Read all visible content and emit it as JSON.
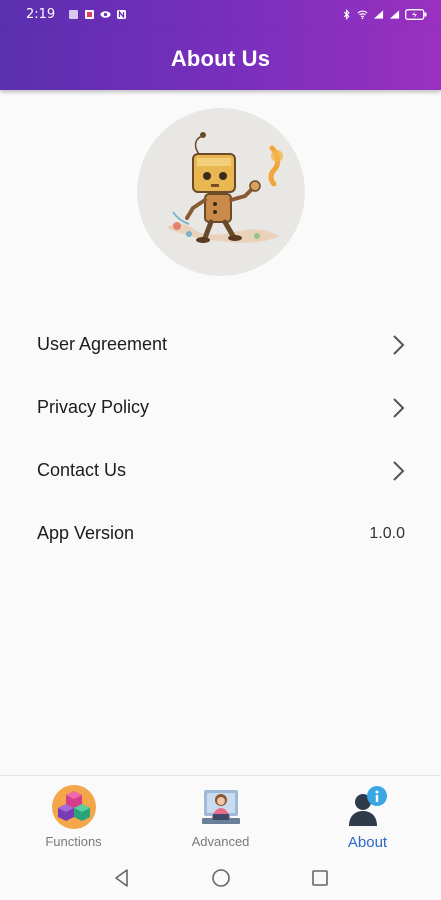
{
  "status_bar": {
    "time": "2:19"
  },
  "app_bar": {
    "title": "About Us"
  },
  "menu": {
    "items": [
      {
        "label": "User Agreement"
      },
      {
        "label": "Privacy Policy"
      },
      {
        "label": "Contact Us"
      }
    ],
    "version": {
      "label": "App Version",
      "value": "1.0.0"
    }
  },
  "bottom_nav": {
    "items": [
      {
        "label": "Functions",
        "icon": "cubes-icon"
      },
      {
        "label": "Advanced",
        "icon": "person-laptop-icon"
      },
      {
        "label": "About",
        "icon": "user-info-icon"
      }
    ],
    "active": "About"
  },
  "colors": {
    "header_start": "#5b2fb0",
    "header_end": "#9a30c0",
    "active_nav": "#2a68c8"
  }
}
